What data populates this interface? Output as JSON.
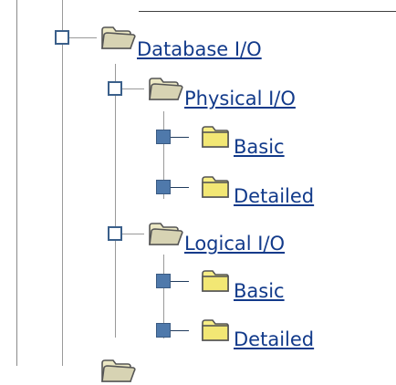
{
  "tree": {
    "root": {
      "label": "Database I/O",
      "state": "expanded",
      "children": [
        {
          "label": "Physical I/O",
          "state": "expanded",
          "children": [
            {
              "label": "Basic"
            },
            {
              "label": "Detailed"
            }
          ]
        },
        {
          "label": "Logical I/O",
          "state": "expanded",
          "children": [
            {
              "label": "Basic"
            },
            {
              "label": "Detailed"
            }
          ]
        }
      ]
    }
  },
  "colors": {
    "link": "#123a8a",
    "tree_line": "#999999",
    "toggle_border": "#3a5f8a",
    "toggle_fill": "#4f79ab",
    "folder_yellow": "#f5e97a",
    "folder_outline": "#555555"
  }
}
